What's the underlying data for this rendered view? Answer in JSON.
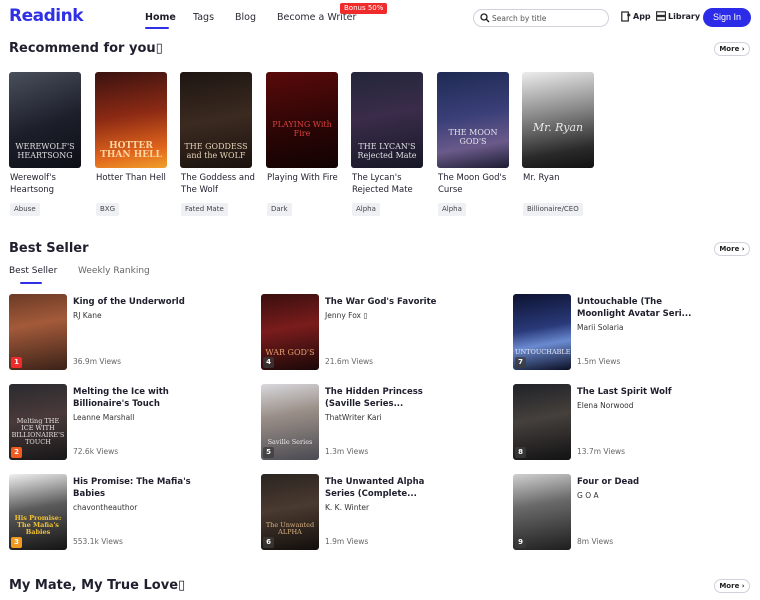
{
  "header": {
    "logo": "Readink",
    "nav": [
      "Home",
      "Tags",
      "Blog",
      "Become a Writer"
    ],
    "bonus": "Bonus 50%",
    "search_placeholder": "Search by title",
    "app_label": "App",
    "library_label": "Library",
    "signin_label": "Sign In"
  },
  "recommend": {
    "title": "Recommend for you▯",
    "more_label": "More",
    "books": [
      {
        "title": "Werewolf's Heartsong",
        "tag": "Abuse",
        "cover_text": "WEREWOLF'S HEARTSONG"
      },
      {
        "title": "Hotter Than Hell",
        "tag": "BXG",
        "cover_text": "HOTTER THAN HELL"
      },
      {
        "title": "The Goddess and The Wolf",
        "tag": "Fated Mate",
        "cover_text": "THE GODDESS and the WOLF"
      },
      {
        "title": "Playing With Fire",
        "tag": "Dark",
        "cover_text": "PLAYING With Fire"
      },
      {
        "title": "The Lycan's Rejected Mate",
        "tag": "Alpha",
        "cover_text": "THE LYCAN'S Rejected Mate"
      },
      {
        "title": "The Moon God's Curse",
        "tag": "Alpha",
        "cover_text": "THE MOON GOD'S"
      },
      {
        "title": "Mr. Ryan",
        "tag": "Billionaire/CEO",
        "cover_text": "Mr. Ryan"
      }
    ]
  },
  "best_seller": {
    "title": "Best Seller",
    "more_label": "More",
    "tabs": [
      "Best Seller",
      "Weekly Ranking"
    ],
    "books": [
      {
        "rank": "1",
        "title": "King of the Underworld",
        "author": "RJ Kane",
        "views": "36.9m Views",
        "cover_text": ""
      },
      {
        "rank": "2",
        "title": "Melting the Ice with Billionaire's Touch",
        "author": "Leanne Marshall",
        "views": "72.6k Views",
        "cover_text": "Melting THE ICE WITH BILLIONAIRE'S TOUCH"
      },
      {
        "rank": "3",
        "title": "His Promise: The Mafia's Babies",
        "author": "chavontheauthor",
        "views": "553.1k Views",
        "cover_text": "His Promise: The Mafia's Babies"
      },
      {
        "rank": "4",
        "title": "The War God's Favorite",
        "author": "Jenny Fox ▯",
        "views": "21.6m Views",
        "cover_text": "WAR GOD'S"
      },
      {
        "rank": "5",
        "title": "The Hidden Princess (Saville Series...",
        "author": "ThatWriter Kari",
        "views": "1.3m Views",
        "cover_text": "Saville Series"
      },
      {
        "rank": "6",
        "title": "The Unwanted Alpha Series (Complete...",
        "author": "K. K. Winter",
        "views": "1.9m Views",
        "cover_text": "The Unwanted ALPHA"
      },
      {
        "rank": "7",
        "title": "Untouchable (The Moonlight Avatar Seri...",
        "author": "Marii Solaria",
        "views": "1.5m Views",
        "cover_text": "UNTOUCHABLE"
      },
      {
        "rank": "8",
        "title": "The Last Spirit Wolf",
        "author": "Elena Norwood",
        "views": "13.7m Views",
        "cover_text": ""
      },
      {
        "rank": "9",
        "title": "Four or Dead",
        "author": "G O A",
        "views": "8m Views",
        "cover_text": ""
      }
    ]
  },
  "mate": {
    "title": "My Mate, My True Love▯",
    "more_label": "More"
  },
  "colors": {
    "accent": "#2f2fe6",
    "bonus": "#ef2b2b"
  }
}
